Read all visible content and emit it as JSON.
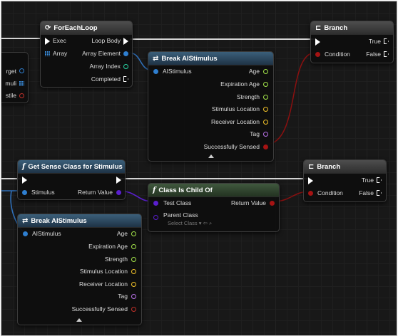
{
  "nodes": {
    "for_each": {
      "title": "ForEachLoop",
      "exec": "Exec",
      "array": "Array",
      "loop_body": "Loop Body",
      "array_element": "Array Element",
      "array_index": "Array Index",
      "completed": "Completed"
    },
    "branch1": {
      "title": "Branch",
      "condition": "Condition",
      "true_label": "True",
      "false_label": "False"
    },
    "branch2": {
      "title": "Branch",
      "condition": "Condition",
      "true_label": "True",
      "false_label": "False"
    },
    "break1": {
      "title": "Break AIStimulus",
      "input": "AIStimulus",
      "outputs": [
        "Age",
        "Expiration Age",
        "Strength",
        "Stimulus Location",
        "Receiver Location",
        "Tag",
        "Successfully Sensed"
      ]
    },
    "break2": {
      "title": "Break AIStimulus",
      "input": "AIStimulus",
      "outputs": [
        "Age",
        "Expiration Age",
        "Strength",
        "Stimulus Location",
        "Receiver Location",
        "Tag",
        "Successfully Sensed"
      ]
    },
    "get_sense": {
      "title": "Get Sense Class for Stimulus",
      "stimulus": "Stimulus",
      "return_value": "Return Value"
    },
    "class_child": {
      "title": "Class Is Child Of",
      "test_class": "Test Class",
      "parent_class": "Parent Class",
      "select_class": "Select Class",
      "return_value": "Return Value"
    },
    "partial": {
      "target": "rget",
      "stimuli": "muli",
      "tile": "stile"
    }
  },
  "colors": {
    "exec": "#ffffff",
    "struct": "#2f7fd0",
    "float": "#a3e44a",
    "vector": "#f2c22a",
    "name": "#b872e8",
    "bool": "#a51313",
    "class": "#5a1fcf",
    "int": "#2ad8a6"
  }
}
